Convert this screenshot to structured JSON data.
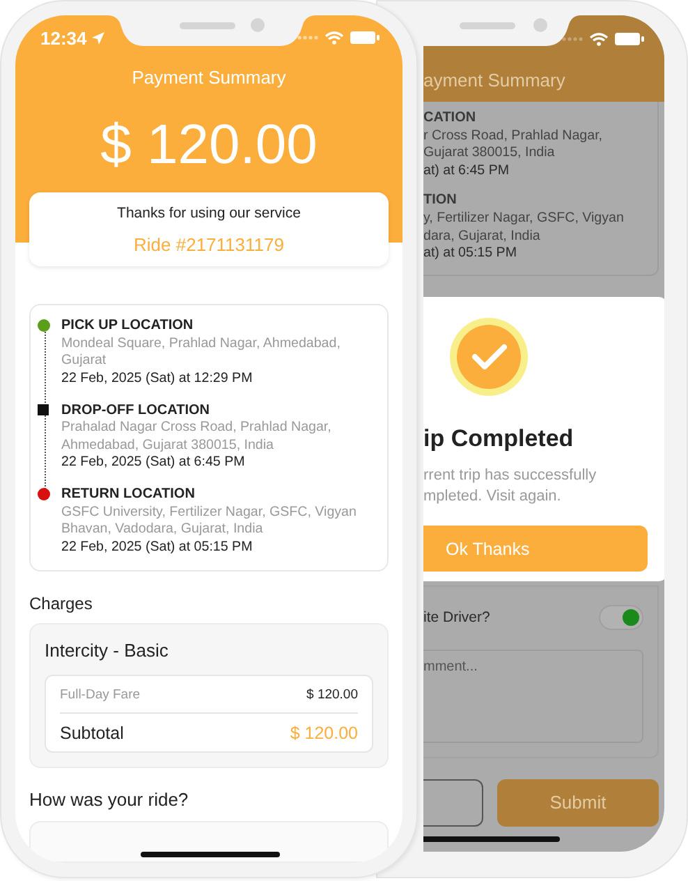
{
  "front_screen": {
    "status_bar": {
      "time": "12:34"
    },
    "title": "Payment Summary",
    "amount": "$ 120.00",
    "thanks": "Thanks for using our service",
    "ride_number": "Ride #2171131179",
    "locations": [
      {
        "kind": "pickup",
        "label": "PICK UP LOCATION",
        "address": "Mondeal Square, Prahlad Nagar, Ahmedabad, Gujarat",
        "time": "22 Feb, 2025 (Sat) at 12:29 PM"
      },
      {
        "kind": "dropoff",
        "label": "DROP-OFF LOCATION",
        "address": "Prahalad Nagar Cross Road, Prahlad Nagar, Ahmedabad, Gujarat 380015, India",
        "time": "22 Feb, 2025 (Sat) at 6:45 PM"
      },
      {
        "kind": "return",
        "label": "RETURN LOCATION",
        "address": "GSFC University, Fertilizer Nagar, GSFC, Vigyan Bhavan, Vadodara, Gujarat, India",
        "time": "22 Feb, 2025 (Sat) at 05:15 PM"
      }
    ],
    "charges_heading": "Charges",
    "charge_card": {
      "title": "Intercity - Basic",
      "rows": [
        {
          "kind": "item",
          "label": "Full-Day Fare",
          "value": "$ 120.00"
        },
        {
          "kind": "subtotal",
          "label": "Subtotal",
          "value": "$ 120.00"
        }
      ]
    },
    "rating_heading": "How was your ride?"
  },
  "back_screen": {
    "title": "ayment Summary",
    "locations": [
      {
        "label": "CATION",
        "lines": [
          "r Cross Road, Prahlad Nagar,",
          "Gujarat 380015, India"
        ],
        "time": "at) at 6:45 PM"
      },
      {
        "label": "TION",
        "lines": [
          "y, Fertilizer Nagar, GSFC, Vigyan",
          "dara, Gujarat, India"
        ],
        "time": "at) at 05:15 PM"
      }
    ],
    "dialog": {
      "title": "ip Completed",
      "lines": [
        "rrent trip has successfully",
        "mpleted. Visit again."
      ],
      "button": "Ok Thanks"
    },
    "favorite": {
      "label": "ite Driver?",
      "on": true
    },
    "comment": {
      "placeholder": "mment..."
    },
    "submit_button": "Submit"
  }
}
